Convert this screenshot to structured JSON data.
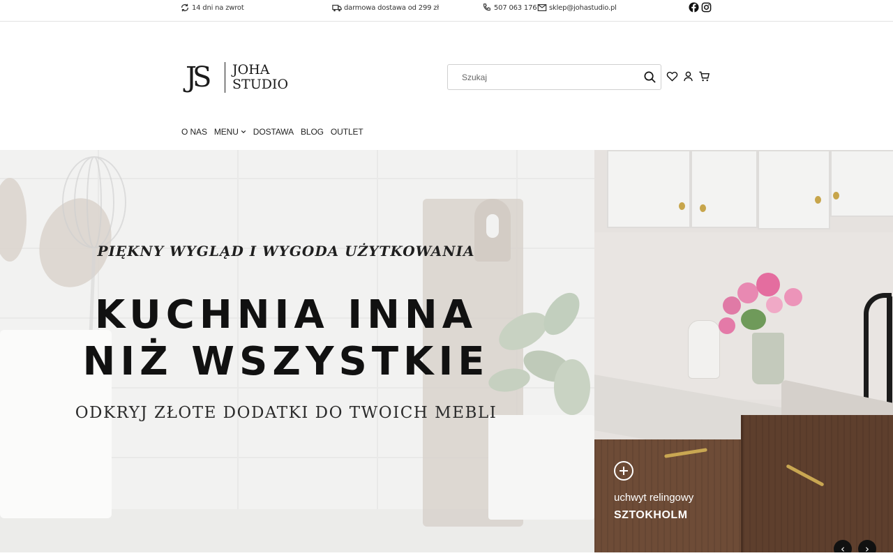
{
  "topbar": {
    "return_text": "14 dni na zwrot",
    "delivery_text": "darmowa dostawa od 299 zł",
    "phone": "507 063 176",
    "email": "sklep@johastudio.pl",
    "icons": [
      "refresh-icon",
      "truck-icon",
      "phone-icon",
      "mail-icon",
      "facebook-icon",
      "instagram-icon"
    ]
  },
  "header": {
    "logo_mark": "JS",
    "logo_line1": "JOHA",
    "logo_line2": "STUDIO",
    "search_placeholder": "Szukaj",
    "icons": [
      "search-icon",
      "heart-icon",
      "user-icon",
      "cart-icon"
    ]
  },
  "nav": {
    "items": [
      {
        "label": "O NAS"
      },
      {
        "label": "MENU",
        "has_dropdown": true
      },
      {
        "label": "DOSTAWA"
      },
      {
        "label": "BLOG"
      },
      {
        "label": "OUTLET"
      }
    ]
  },
  "hero": {
    "tagline": "PIĘKNY WYGLĄD I WYGODA UŻYTKOWANIA",
    "headline_line1": "KUCHNIA INNA",
    "headline_line2": "NIŻ WSZYSTKIE",
    "subheadline": "ODKRYJ ZŁOTE DODATKI DO TWOICH MEBLI"
  },
  "promo": {
    "subtitle": "uchwyt relingowy",
    "title": "SZTOKHOLM"
  },
  "slider": {
    "prev_label": "‹",
    "next_label": "›"
  },
  "colors": {
    "accent_gold": "#c9a752",
    "text_dark": "#111111",
    "wood": "#5e3f2d"
  }
}
